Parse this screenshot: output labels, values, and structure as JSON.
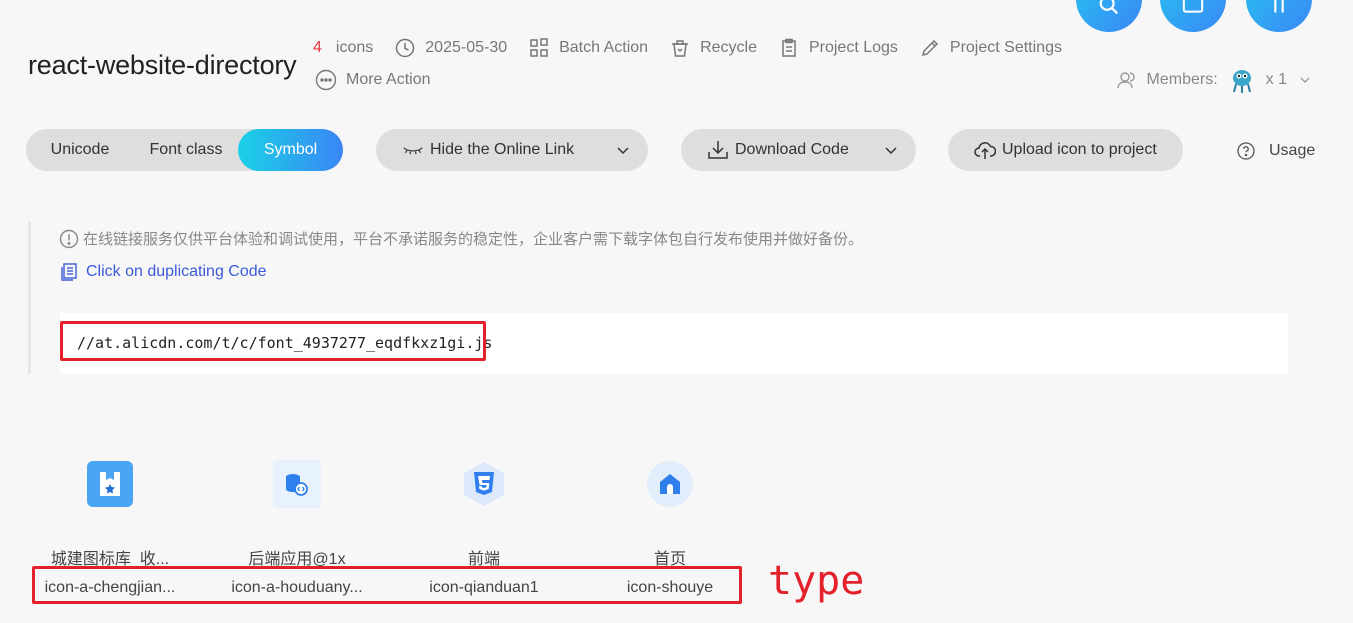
{
  "project": {
    "title": "react-website-directory",
    "icon_count": "4",
    "icons_label": "icons",
    "date": "2025-05-30",
    "batch_action": "Batch Action",
    "recycle": "Recycle",
    "project_logs": "Project Logs",
    "project_settings": "Project Settings",
    "more_action": "More Action",
    "members_label": "Members:",
    "members_count": "x 1"
  },
  "toolbar": {
    "segments": [
      "Unicode",
      "Font class",
      "Symbol"
    ],
    "selected_segment": "Symbol",
    "hide_link": "Hide the Online Link",
    "download_code": "Download Code",
    "upload_icon": "Upload icon to project",
    "usage": "Usage"
  },
  "link_panel": {
    "notice": "在线链接服务仅供平台体验和调试使用，平台不承诺服务的稳定性，企业客户需下载字体包自行发布使用并做好备份。",
    "copy_label": "Click on duplicating Code",
    "url": "//at.alicdn.com/t/c/font_4937277_eqdfkxz1gi.js"
  },
  "icons": [
    {
      "name": "城建图标库_收...",
      "code": "icon-a-chengjian...",
      "icon": "star-folder-icon"
    },
    {
      "name": "后端应用@1x",
      "code": "icon-a-houduany...",
      "icon": "database-code-icon"
    },
    {
      "name": "前端",
      "code": "icon-qianduan1",
      "icon": "css3-icon"
    },
    {
      "name": "首页",
      "code": "icon-shouye",
      "icon": "home-icon"
    }
  ],
  "annotation": "type",
  "colors": {
    "accent_gradient_start": "#1ad1e6",
    "accent_gradient_end": "#3a86f5",
    "count_red": "#e4393c",
    "annotation_red": "#e4202a",
    "link_blue": "#3a5bd9"
  }
}
